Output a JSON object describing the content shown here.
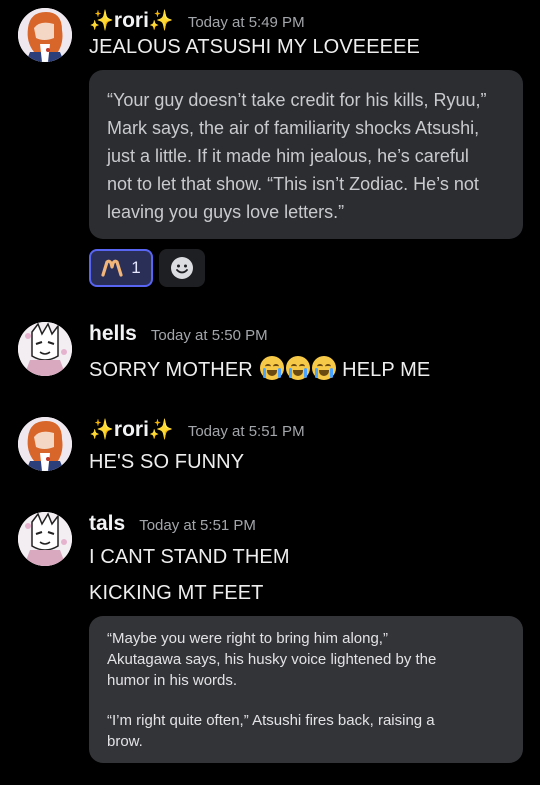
{
  "messages": [
    {
      "username": "rori",
      "sparkles": "✨",
      "timestamp": "Today at 5:49 PM",
      "lines": [
        "JEALOUS ATSUSHI MY LOVEEEEE"
      ],
      "quote_lines": [
        "“Your guy doesn’t take credit for his kills, Ryuu,”",
        "Mark says, the air of familiarity shocks Atsushi,",
        "just a little. If it made him jealous, he’s careful",
        "not to let that show. “This isn’t Zodiac. He’s not",
        "leaving you guys love letters.”"
      ],
      "reactions": [
        {
          "emoji": "hands-heart",
          "count": "1"
        },
        {
          "emoji": "add-reaction",
          "count": ""
        }
      ]
    },
    {
      "username": "hells",
      "timestamp": "Today at 5:50 PM",
      "text_before": "SORRY MOTHER",
      "emoji": "loudly-crying-face",
      "text_after": "HELP ME"
    },
    {
      "username": "rori",
      "sparkles": "✨",
      "timestamp": "Today at 5:51 PM",
      "lines": [
        "HE'S SO FUNNY"
      ]
    },
    {
      "username": "tals",
      "timestamp": "Today at 5:51 PM",
      "lines": [
        "I CANT STAND THEM",
        "KICKING MT FEET"
      ],
      "quote_lines": [
        "“Maybe you were right to bring him along,”",
        "Akutagawa says, his husky voice lightened by the",
        "humor in his words.",
        "“I’m right quite often,” Atsushi fires back, raising a",
        "brow."
      ]
    }
  ],
  "colors": {
    "background": "#000000",
    "card": "#2b2d31",
    "reaction_active_border": "#5865f2",
    "sparkle": "#f5c518",
    "timestamp": "#a3a6aa"
  }
}
